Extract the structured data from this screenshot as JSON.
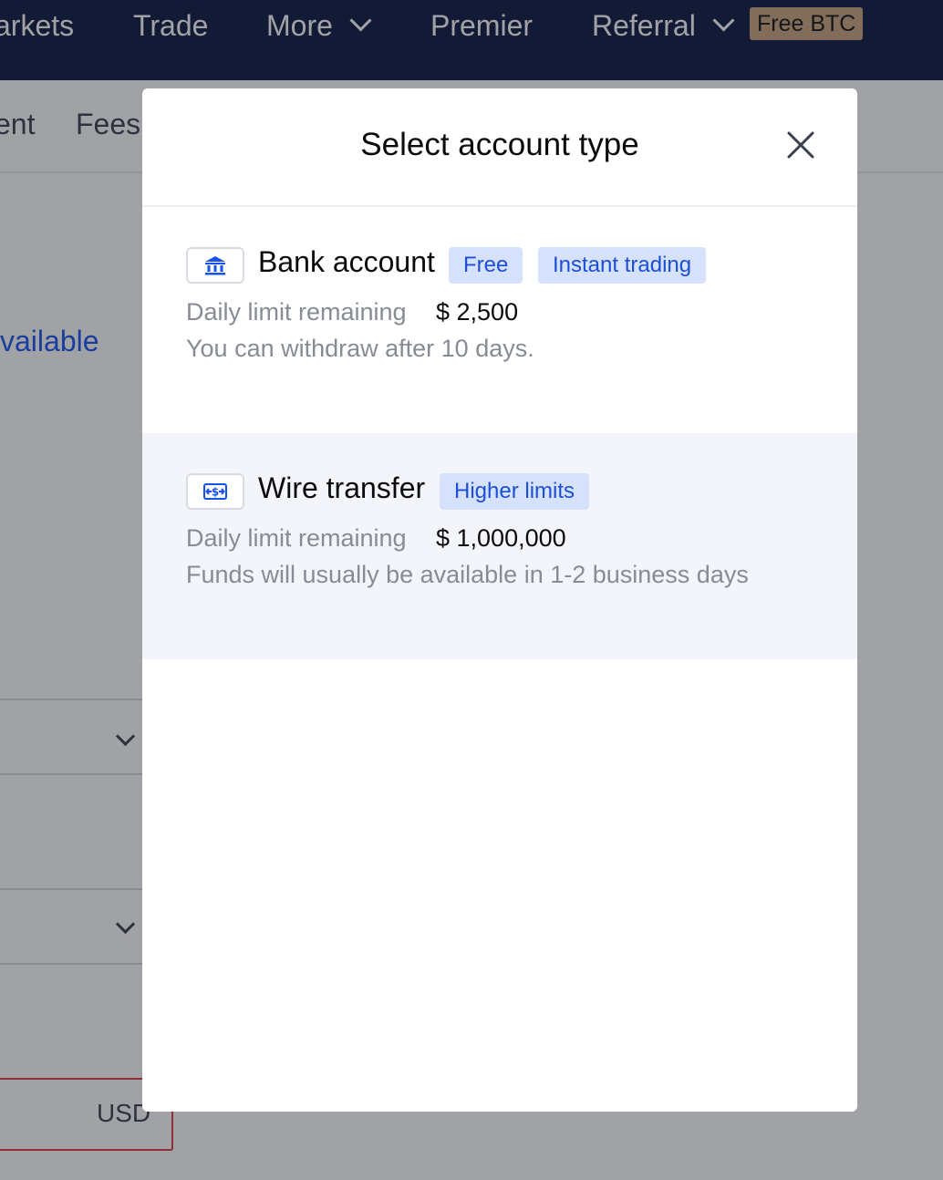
{
  "nav": {
    "items": [
      "arkets",
      "Trade",
      "More",
      "Premier",
      "Referral"
    ],
    "badge": "Free BTC"
  },
  "subnav": {
    "items": [
      "ent",
      "Fees"
    ]
  },
  "background": {
    "available_link": "vailable",
    "currency": "USD"
  },
  "modal": {
    "title": "Select account type",
    "options": [
      {
        "title": "Bank account",
        "icon": "bank-icon",
        "tags": [
          "Free",
          "Instant trading"
        ],
        "limit_label": "Daily limit remaining",
        "limit_value": "$ 2,500",
        "note": "You can withdraw after 10 days."
      },
      {
        "title": "Wire transfer",
        "icon": "wire-transfer-icon",
        "tags": [
          "Higher limits"
        ],
        "limit_label": "Daily limit remaining",
        "limit_value": "$ 1,000,000",
        "note": "Funds will usually be available in 1-2 business days"
      }
    ]
  },
  "colors": {
    "nav_bg": "#0c1541",
    "accent": "#1652f0",
    "tag_bg": "#d6e1fb",
    "tag_text": "#1c4fd6",
    "badge_bg": "#c9a47f"
  }
}
